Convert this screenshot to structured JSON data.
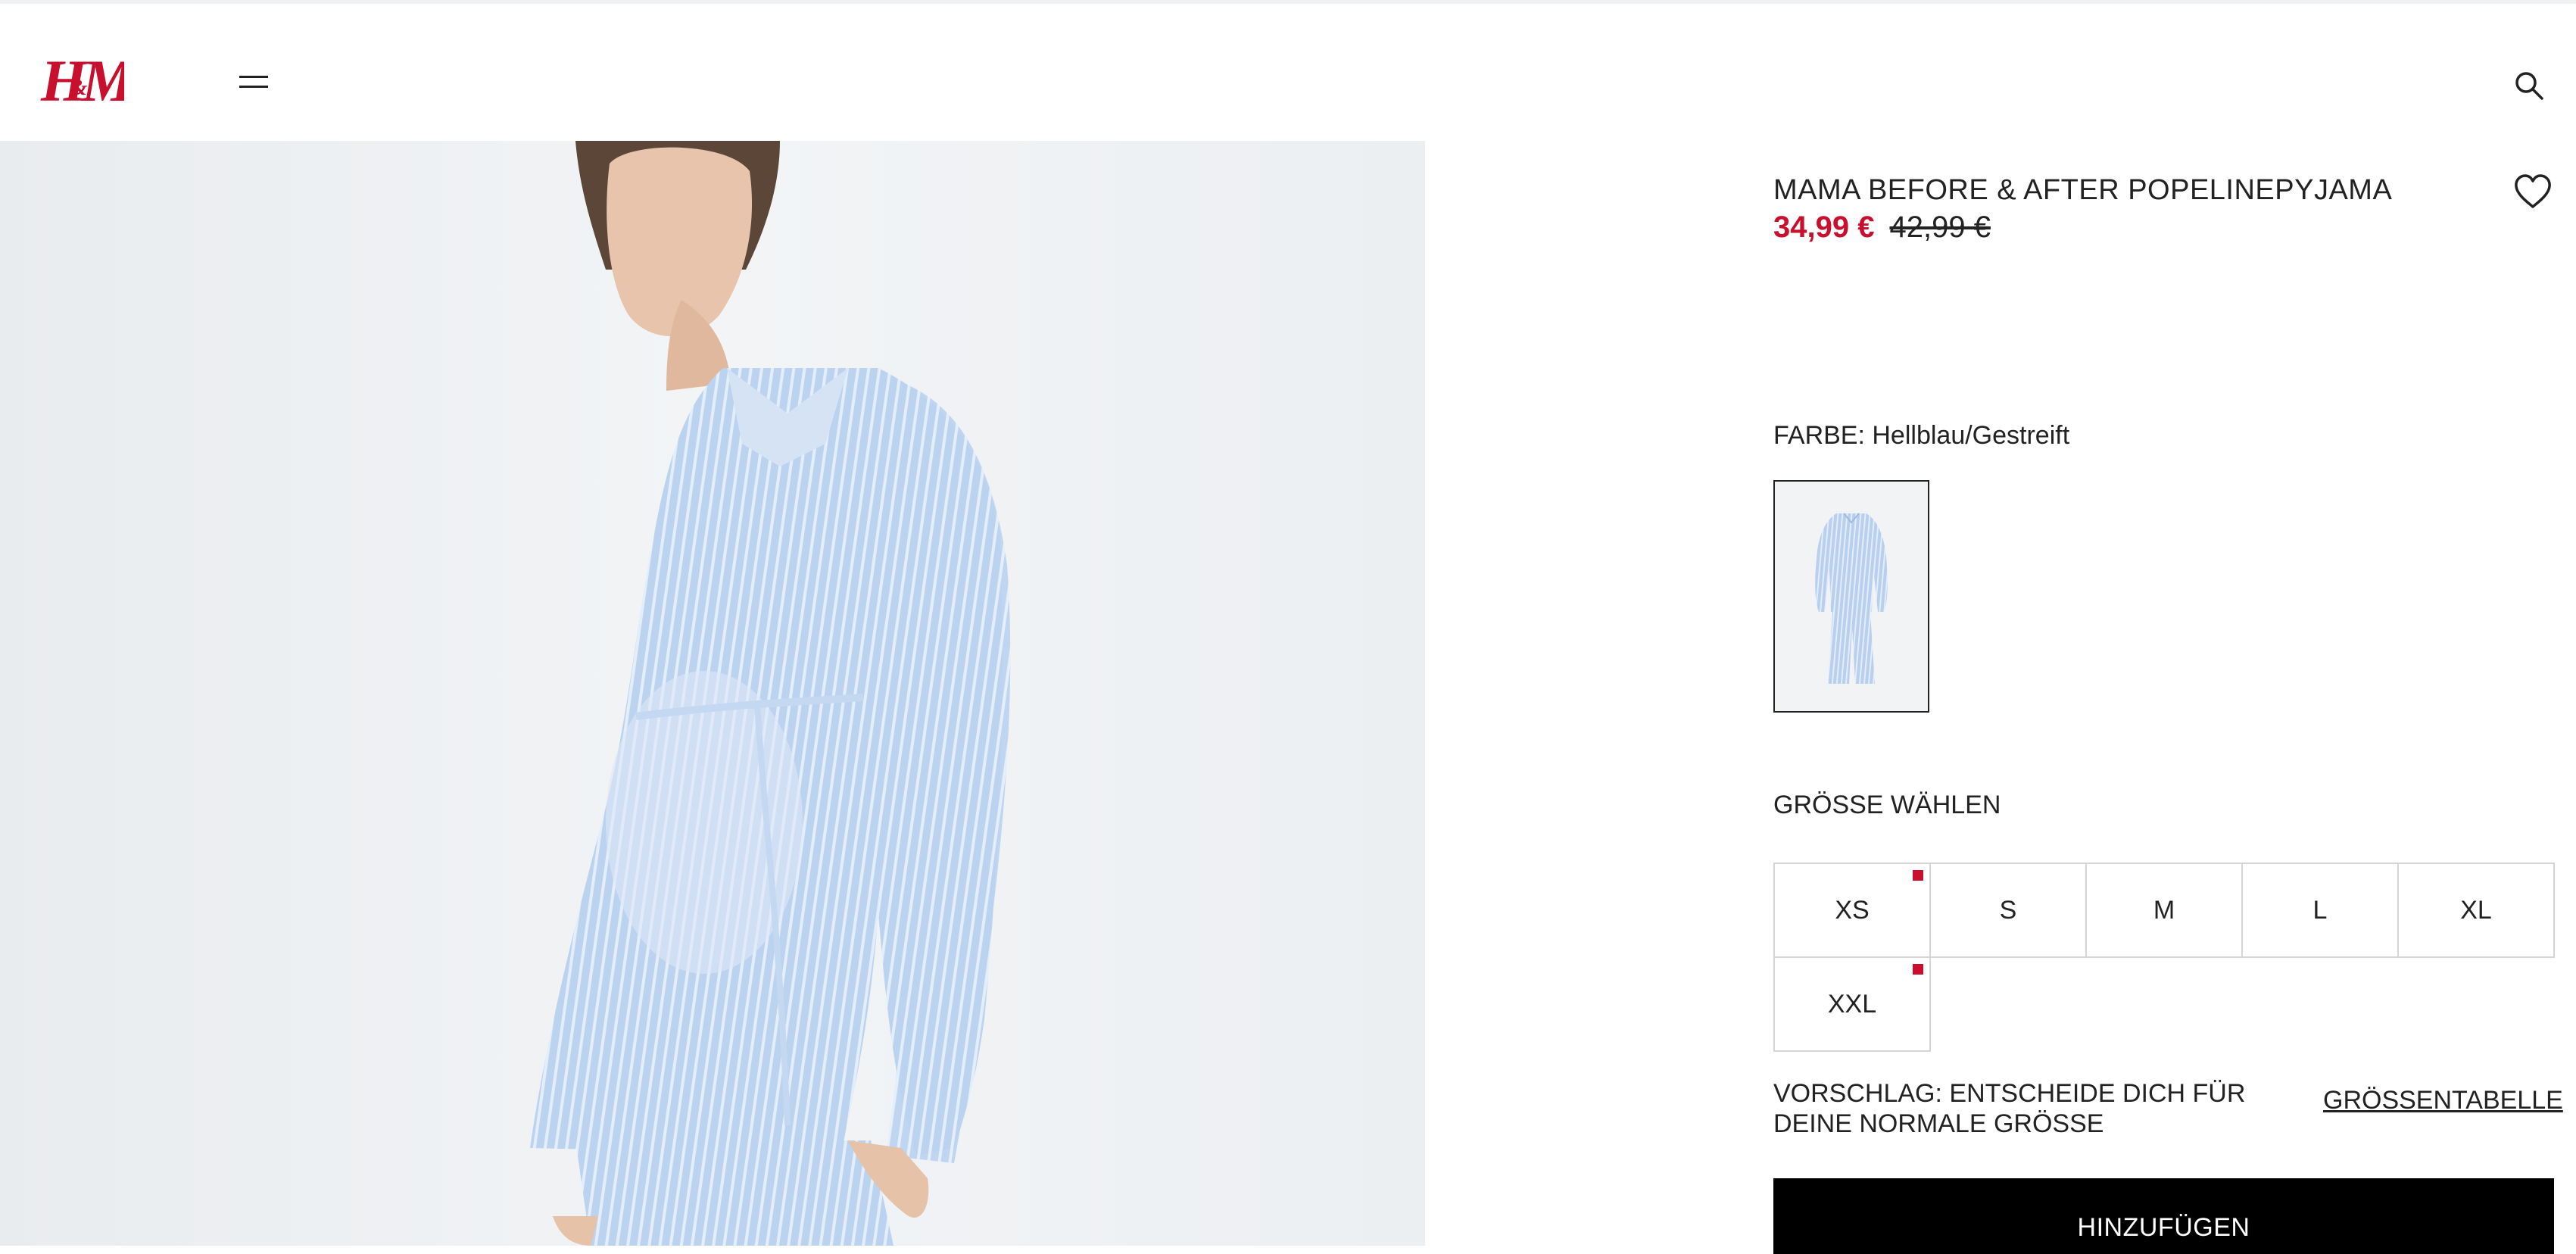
{
  "brand": {
    "logo_text": "H&M",
    "accent_color": "#c8102e"
  },
  "header": {
    "menu_icon": "menu-icon",
    "search_icon": "search-icon"
  },
  "product": {
    "name": "MAMA BEFORE & AFTER POPELINEPYJAMA",
    "price_sale": "34,99 €",
    "price_original": "42,99 €",
    "favorite_icon": "heart-icon",
    "color": {
      "label": "FARBE: Hellblau/Gestreift"
    },
    "size": {
      "label": "GRÖSSE WÄHLEN",
      "options": [
        {
          "label": "XS",
          "low_stock": true
        },
        {
          "label": "S",
          "low_stock": false
        },
        {
          "label": "M",
          "low_stock": false
        },
        {
          "label": "L",
          "low_stock": false
        },
        {
          "label": "XL",
          "low_stock": false
        },
        {
          "label": "XXL",
          "low_stock": true
        }
      ],
      "suggestion": "VORSCHLAG: ENTSCHEIDE DICH FÜR DEINE NORMALE GRÖSSE",
      "size_chart_link": "GRÖSSENTABELLE"
    },
    "add_to_cart": "HINZUFÜGEN"
  }
}
